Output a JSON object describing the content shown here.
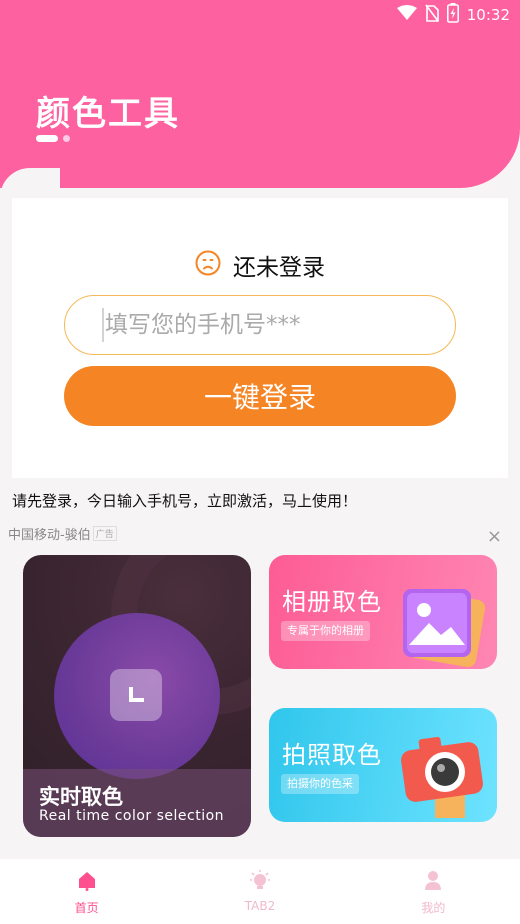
{
  "status_bar": {
    "time": "10:32",
    "icons": [
      "wifi-icon",
      "sim-off-icon",
      "battery-charging-icon"
    ]
  },
  "header": {
    "title": "颜色工具",
    "color": "#fe61a0"
  },
  "login": {
    "status_text": "还未登录",
    "status_icon": "sad-face-icon",
    "phone_placeholder": "填写您的手机号***",
    "phone_value": "",
    "button_label": "一键登录",
    "button_color": "#f58424",
    "notice": "请先登录，今日输入手机号，立即激活，马上使用！"
  },
  "ad": {
    "text": "中国移动-骏伯",
    "tag": "广告",
    "close": "×"
  },
  "features": {
    "realtime": {
      "title": "实时取色",
      "subtitle": "Real time color selection",
      "icon": "crop-icon"
    },
    "album": {
      "title": "相册取色",
      "subtitle": "专属于你的相册",
      "icon": "image-icon",
      "color": "#fd5c94"
    },
    "photo": {
      "title": "拍照取色",
      "subtitle": "拍摄你的色采",
      "icon": "camera-icon",
      "color": "#30c6ec"
    }
  },
  "bottom_nav": {
    "items": [
      {
        "label": "首页",
        "icon": "home-icon",
        "active": true
      },
      {
        "label": "TAB2",
        "icon": "bulb-icon",
        "active": false
      },
      {
        "label": "我的",
        "icon": "user-icon",
        "active": false
      }
    ],
    "active_color": "#fe4f8f"
  }
}
